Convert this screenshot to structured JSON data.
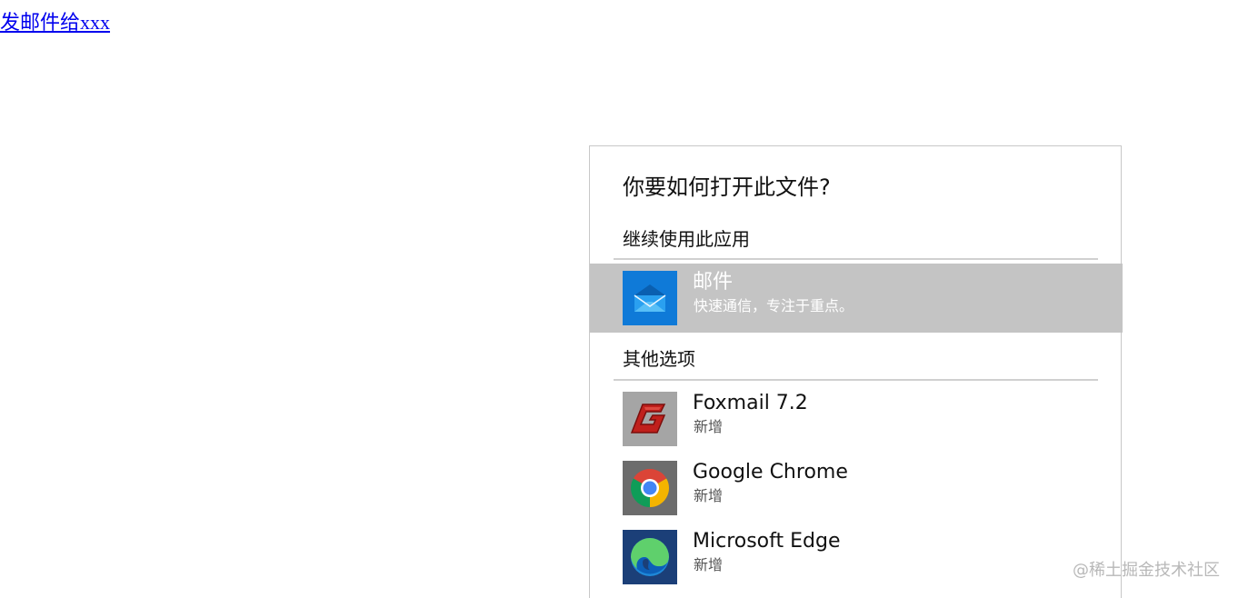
{
  "link": {
    "text": "发邮件给xxx"
  },
  "dialog": {
    "title": "你要如何打开此文件?",
    "sections": {
      "continue": {
        "header": "继续使用此应用",
        "apps": [
          {
            "name": "邮件",
            "description": "快速通信，专注于重点。",
            "icon": "mail-envelope-icon",
            "selected": true,
            "tile_color": "#0f7ad8"
          }
        ]
      },
      "other": {
        "header": "其他选项",
        "apps": [
          {
            "name": "Foxmail 7.2",
            "description": "新增",
            "icon": "foxmail-icon",
            "tile_color": "#a5a5a5"
          },
          {
            "name": "Google Chrome",
            "description": "新增",
            "icon": "chrome-icon",
            "tile_color": "#6c6c6c"
          },
          {
            "name": "Microsoft Edge",
            "description": "新增",
            "icon": "edge-icon",
            "tile_color": "#1b3f78"
          }
        ]
      }
    },
    "selected_highlight_color": "#c4c4c4"
  },
  "watermark": {
    "text": "@稀土掘金技术社区"
  }
}
